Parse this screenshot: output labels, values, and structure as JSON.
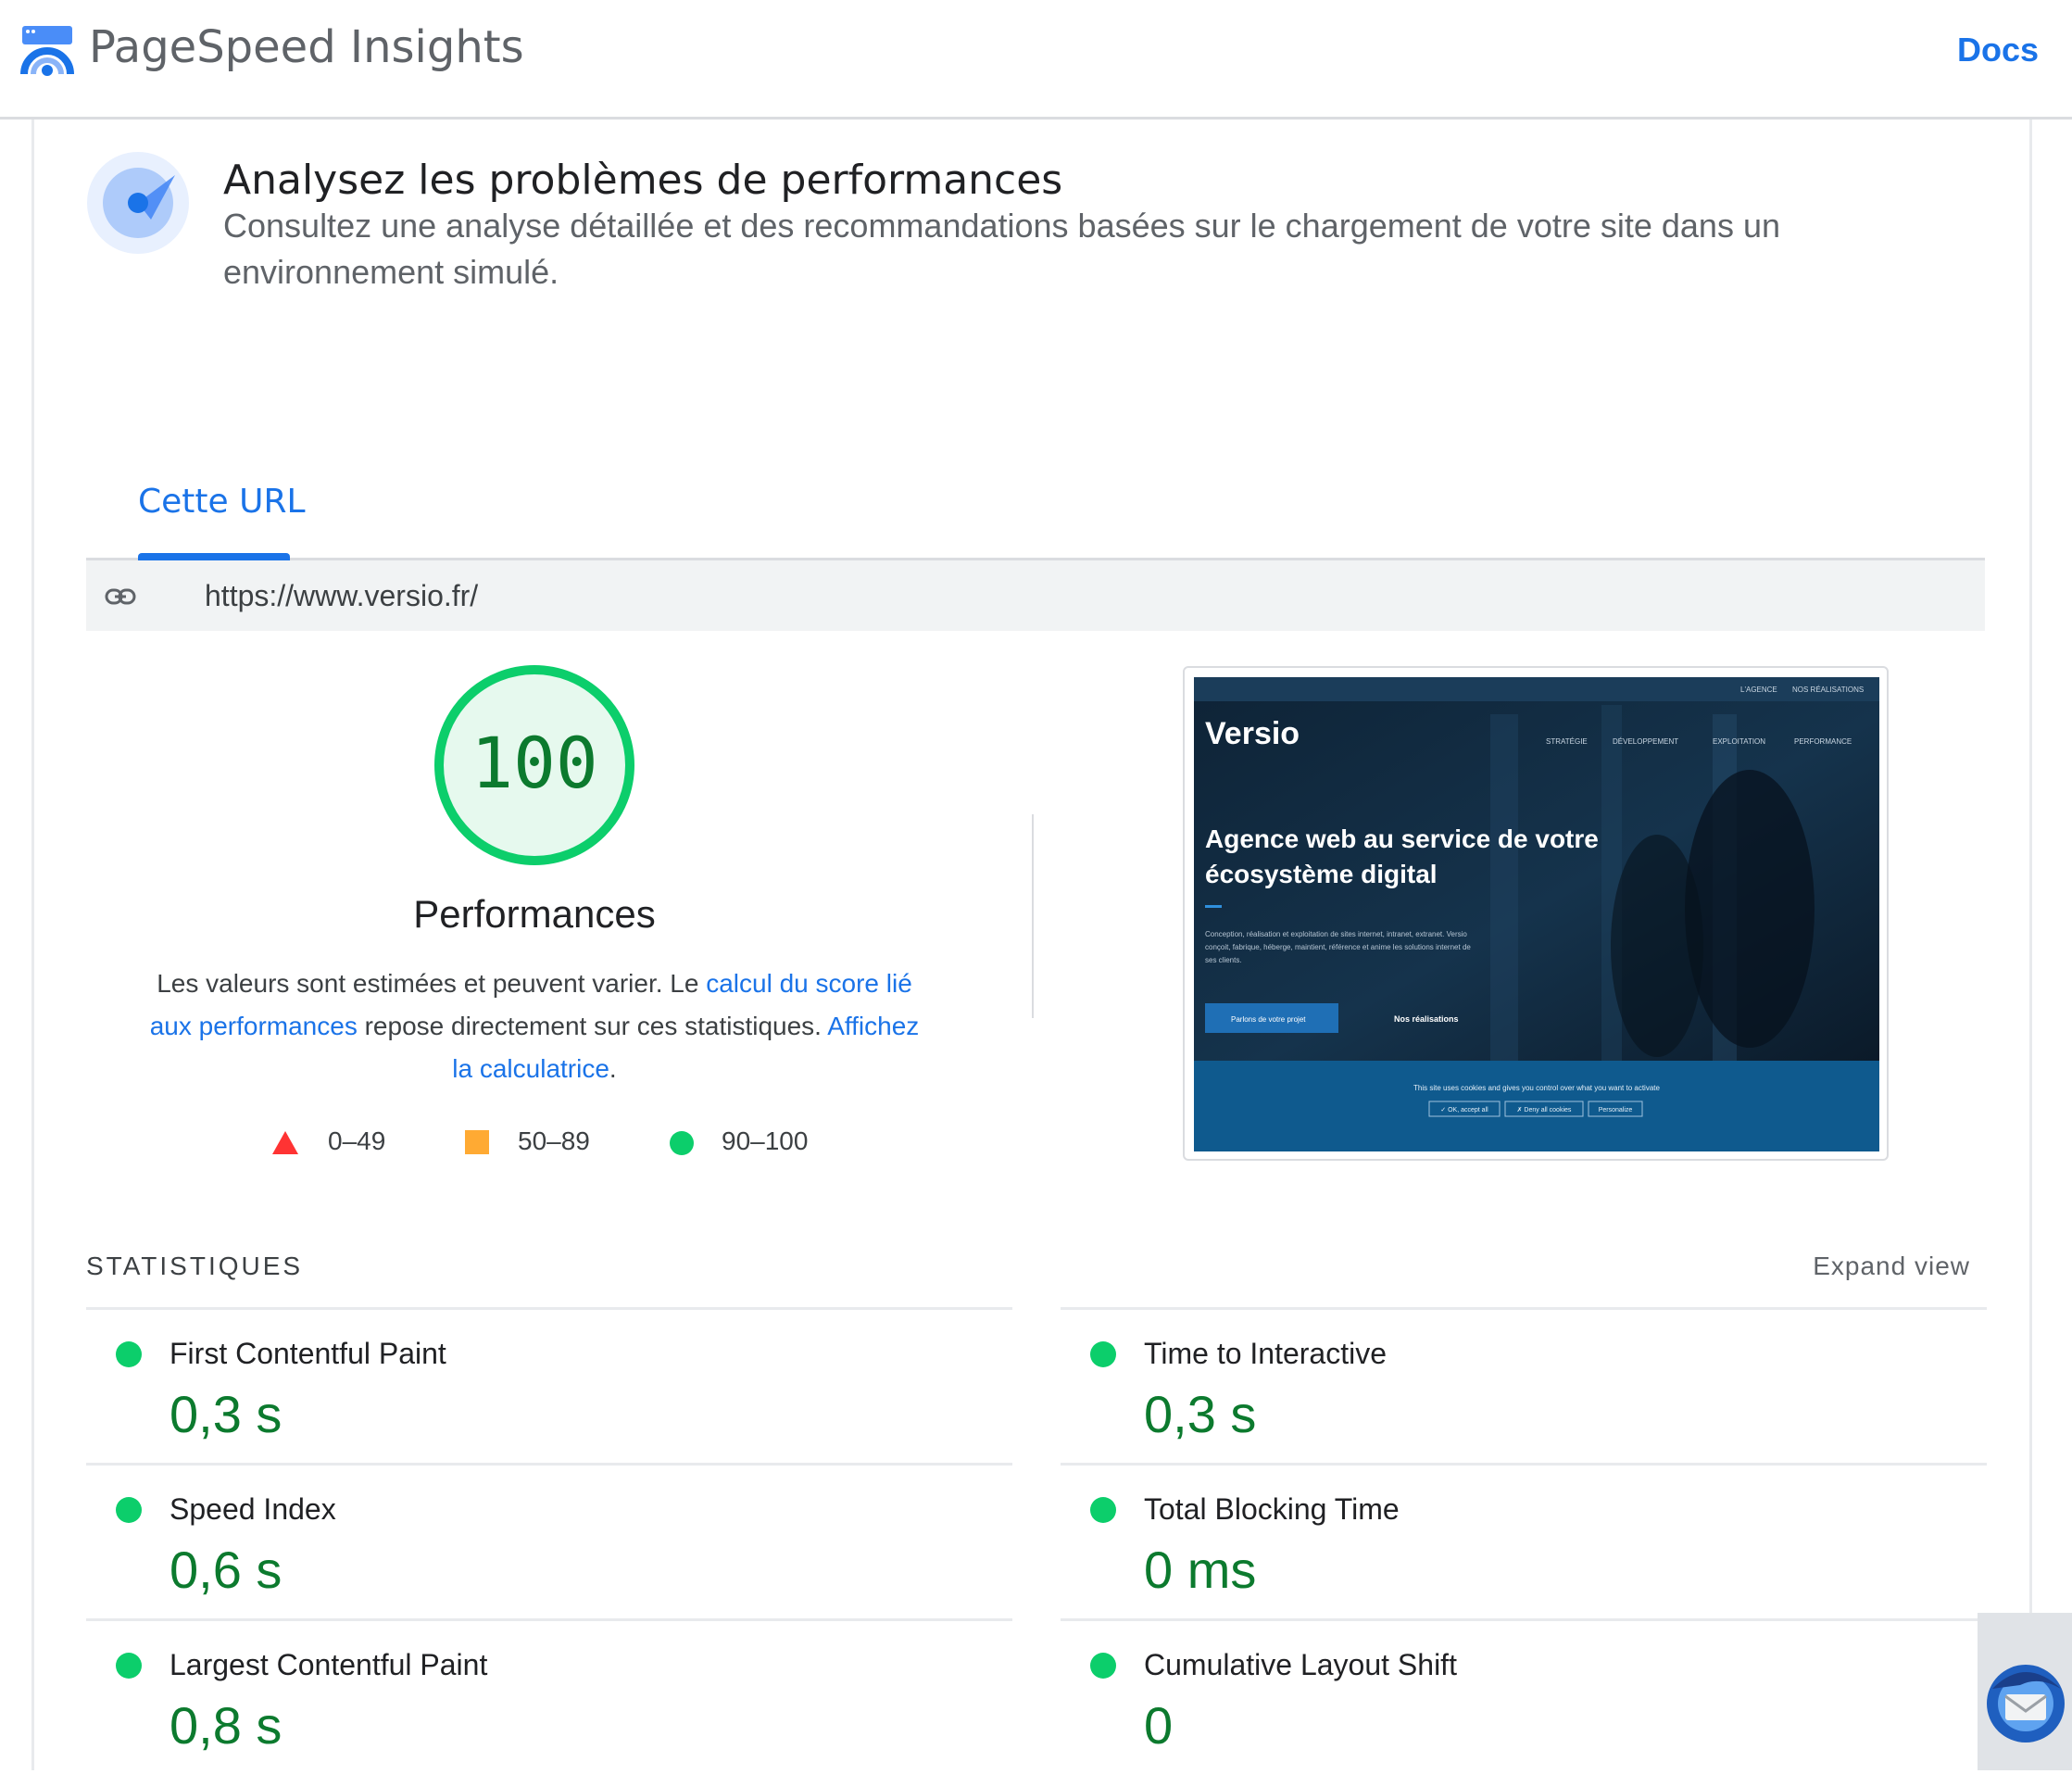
{
  "header": {
    "app_title": "PageSpeed Insights",
    "docs_label": "Docs"
  },
  "intro": {
    "title": "Analysez les problèmes de performances",
    "description": "Consultez une analyse détaillée et des recommandations basées sur le chargement de votre site dans un environnement simulé."
  },
  "tabs": [
    {
      "label": "Cette URL",
      "active": true
    }
  ],
  "url": "https://www.versio.fr/",
  "score": {
    "value": "100",
    "fraction": 1.0,
    "label": "Performances",
    "color": "#0cce6b"
  },
  "description": {
    "part1": "Les valeurs sont estimées et peuvent varier. Le ",
    "link1": "calcul du score lié aux performances",
    "part2": " repose directement sur ces statistiques. ",
    "link2": "Affichez la calculatrice",
    "part3": "."
  },
  "legend": [
    {
      "shape": "triangle",
      "range": "0–49",
      "color": "#ff3333"
    },
    {
      "shape": "square",
      "range": "50–89",
      "color": "#ffaa33"
    },
    {
      "shape": "circle",
      "range": "90–100",
      "color": "#0cce6b"
    }
  ],
  "preview": {
    "logo": "Versio",
    "top_links": [
      "L'AGENCE",
      "NOS RÉALISATIONS"
    ],
    "nav": [
      "STRATÉGIE",
      "DÉVELOPPEMENT",
      "EXPLOITATION",
      "PERFORMANCE"
    ],
    "headline_line1": "Agence web au service de votre",
    "headline_line2": "écosystème digital",
    "body_line1": "Conception, réalisation et exploitation de sites internet, intranet, extranet. Versio",
    "body_line2": "conçoit, fabrique, héberge, maintient, référence et anime les solutions internet de",
    "body_line3": "ses clients.",
    "cta_primary": "Parlons de votre projet",
    "cta_secondary": "Nos réalisations",
    "cookie_text": "This site uses cookies and gives you control over what you want to activate",
    "cookie_buttons": [
      "✓ OK, accept all",
      "✗ Deny all cookies",
      "Personalize"
    ]
  },
  "stats": {
    "header": "STATISTIQUES",
    "expand_label": "Expand view",
    "metrics": [
      {
        "name": "First Contentful Paint",
        "value": "0,3 s"
      },
      {
        "name": "Time to Interactive",
        "value": "0,3 s"
      },
      {
        "name": "Speed Index",
        "value": "0,6 s"
      },
      {
        "name": "Total Blocking Time",
        "value": "0 ms"
      },
      {
        "name": "Largest Contentful Paint",
        "value": "0,8 s"
      },
      {
        "name": "Cumulative Layout Shift",
        "value": "0"
      }
    ]
  },
  "colors": {
    "accent": "#1a73e8",
    "pass": "#0cce6b",
    "pass_text": "#0c7a2e"
  },
  "icons": {
    "logo": "pagespeed-gauge-icon",
    "intro": "lab-radar-icon",
    "url": "link-icon",
    "corner": "thunderbird-icon"
  }
}
